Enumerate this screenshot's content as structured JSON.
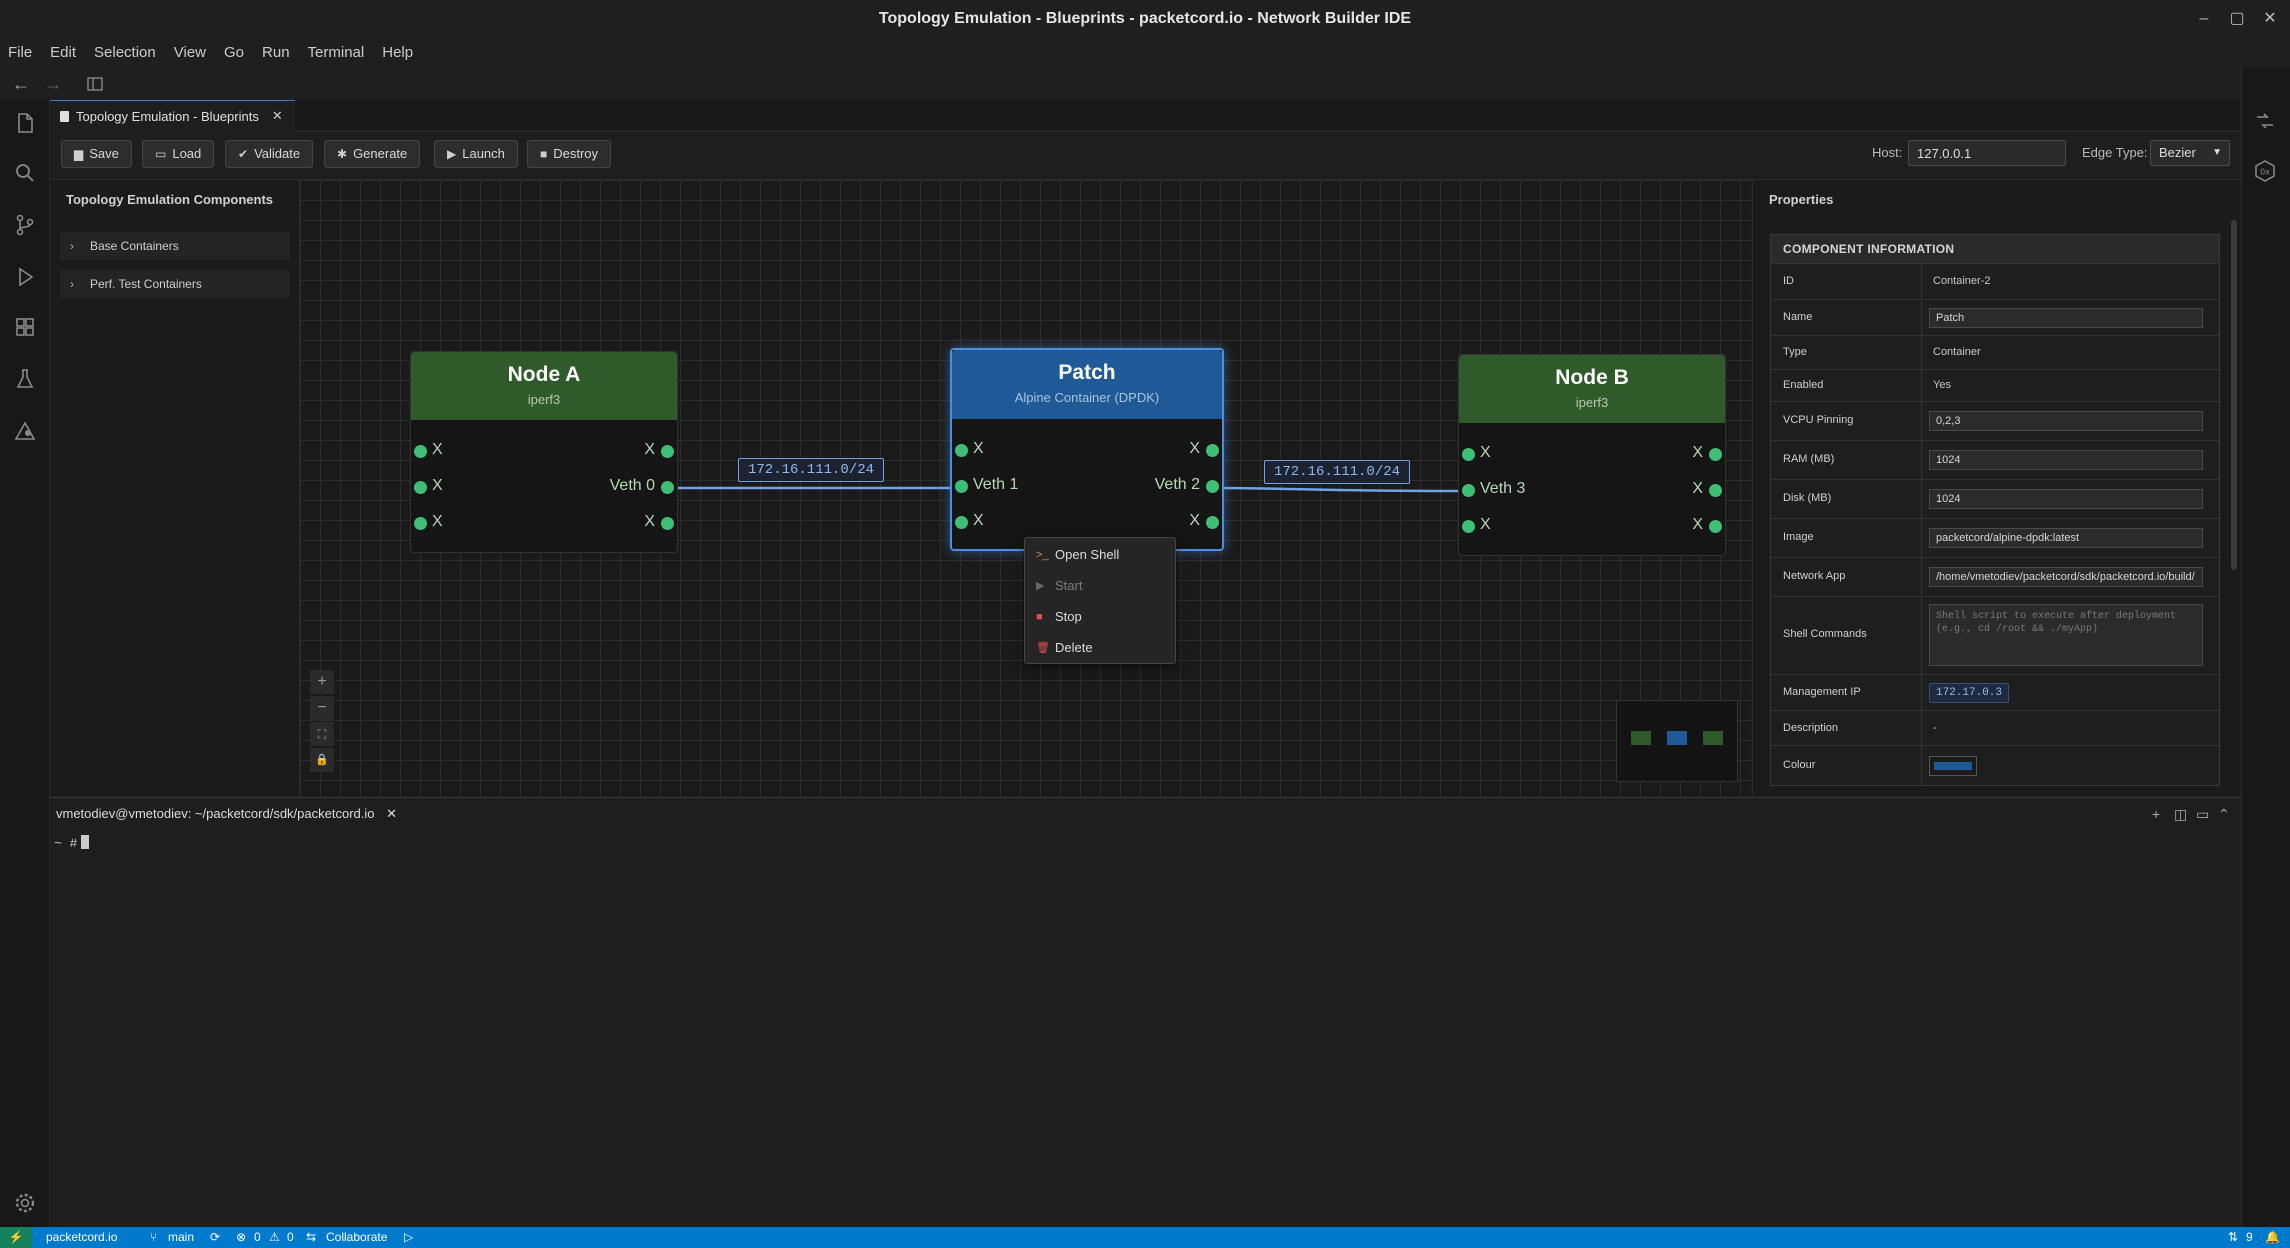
{
  "window": {
    "title": "Topology Emulation - Blueprints - packetcord.io - Network Builder IDE"
  },
  "menu": [
    "File",
    "Edit",
    "Selection",
    "View",
    "Go",
    "Run",
    "Terminal",
    "Help"
  ],
  "editor_tab": {
    "label": "Topology Emulation - Blueprints"
  },
  "toolbar": {
    "buttons": [
      {
        "label": "Save",
        "icon": "save-icon"
      },
      {
        "label": "Load",
        "icon": "folder-icon"
      },
      {
        "label": "Validate",
        "icon": "check-circle-icon"
      },
      {
        "label": "Generate",
        "icon": "gears-icon"
      },
      {
        "label": "Launch",
        "icon": "play-icon"
      },
      {
        "label": "Destroy",
        "icon": "stop-icon"
      }
    ],
    "host_label": "Host:",
    "host_value": "127.0.0.1",
    "edge_type_label": "Edge Type:",
    "edge_type_value": "Bezier"
  },
  "components_panel": {
    "title": "Topology Emulation Components",
    "categories": [
      "Base Containers",
      "Perf. Test Containers"
    ]
  },
  "canvas": {
    "nodes": [
      {
        "name": "Node A",
        "subtitle": "iperf3",
        "color": "#2f5a2a",
        "ports_left": [
          "X",
          "X",
          "X"
        ],
        "ports_right": [
          "X",
          "Veth 0",
          "X"
        ]
      },
      {
        "name": "Patch",
        "subtitle": "Alpine Container (DPDK)",
        "color": "#1f5a96",
        "ports_left": [
          "X",
          "Veth 1",
          "X"
        ],
        "ports_right": [
          "X",
          "Veth 2",
          "X"
        ]
      },
      {
        "name": "Node B",
        "subtitle": "iperf3",
        "color": "#2f5a2a",
        "ports_left": [
          "X",
          "Veth 3",
          "X"
        ],
        "ports_right": [
          "X",
          "X",
          "X"
        ]
      }
    ],
    "links": [
      {
        "label": "172.16.111.0/24"
      },
      {
        "label": "172.16.111.0/24"
      }
    ],
    "zoom_controls": [
      "+",
      "−",
      "⛶",
      "🔒"
    ]
  },
  "context_menu": {
    "items": [
      {
        "label": "Open Shell",
        "icon": "terminal-icon",
        "enabled": true
      },
      {
        "label": "Start",
        "icon": "play-icon",
        "enabled": false
      },
      {
        "label": "Stop",
        "icon": "stop-icon",
        "enabled": true
      },
      {
        "label": "Delete",
        "icon": "trash-icon",
        "enabled": true
      }
    ]
  },
  "properties": {
    "title": "Properties",
    "section": "COMPONENT INFORMATION",
    "rows": [
      {
        "key": "ID",
        "value": "Container-2"
      },
      {
        "key": "Name",
        "value": "Patch"
      },
      {
        "key": "Type",
        "value": "Container"
      },
      {
        "key": "Enabled",
        "value": "Yes"
      },
      {
        "key": "VCPU Pinning",
        "value": "0,2,3"
      },
      {
        "key": "RAM (MB)",
        "value": "1024"
      },
      {
        "key": "Disk (MB)",
        "value": "1024"
      },
      {
        "key": "Image",
        "value": "packetcord/alpine-dpdk:latest"
      },
      {
        "key": "Network App",
        "value": "/home/vmetodiev/packetcord/sdk/packetcord.io/build/"
      },
      {
        "key": "Shell Commands",
        "placeholder": "Shell script to execute after deployment (e.g., cd /root && ./myApp)"
      },
      {
        "key": "Management IP",
        "value": "172.17.0.3"
      },
      {
        "key": "Description",
        "value": "-"
      },
      {
        "key": "Colour",
        "value": "#1f5a96"
      }
    ]
  },
  "terminal": {
    "tab_label": "vmetodiev@vmetodiev: ~/packetcord/sdk/packetcord.io",
    "prompt": "~ #"
  },
  "statusbar": {
    "remote": "packetcord.io",
    "branch": "main",
    "errors": "0",
    "warnings": "0",
    "collaborate": "Collaborate",
    "ports": "9"
  }
}
